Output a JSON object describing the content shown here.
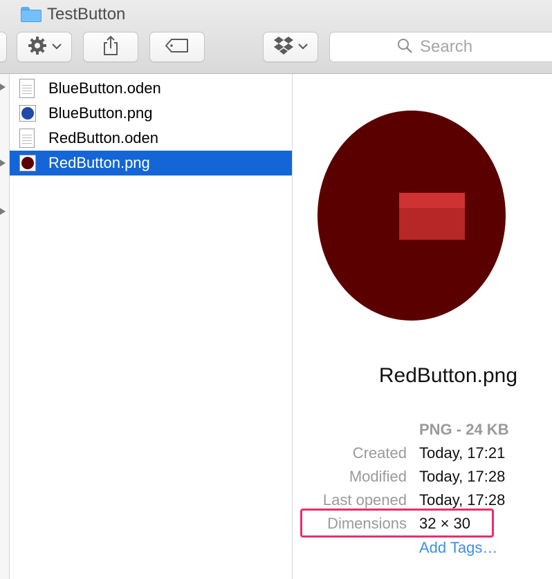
{
  "window": {
    "title": "TestButton"
  },
  "toolbar": {
    "action_icon": "gear-icon",
    "share_icon": "share-icon",
    "tags_icon": "tag-icon",
    "dropbox_icon": "dropbox-icon",
    "search_placeholder": "Search"
  },
  "files": [
    {
      "name": "BlueButton.oden",
      "kind": "doc"
    },
    {
      "name": "BlueButton.png",
      "kind": "png-blue"
    },
    {
      "name": "RedButton.oden",
      "kind": "doc"
    },
    {
      "name": "RedButton.png",
      "kind": "png-red",
      "selected": true
    }
  ],
  "preview": {
    "file_name": "RedButton.png",
    "kind_size": "PNG - 24 KB",
    "created_label": "Created",
    "created_value": "Today, 17:21",
    "modified_label": "Modified",
    "modified_value": "Today, 17:28",
    "last_opened_label": "Last opened",
    "last_opened_value": "Today, 17:28",
    "dimensions_label": "Dimensions",
    "dimensions_value": "32 × 30",
    "add_tags": "Add Tags…"
  },
  "colors": {
    "selection": "#1466d6",
    "preview_dark_red": "#5a0000",
    "preview_rect_red": "#c92b2b",
    "highlight_pink": "#ea2d69",
    "link_blue": "#3e8de8"
  }
}
